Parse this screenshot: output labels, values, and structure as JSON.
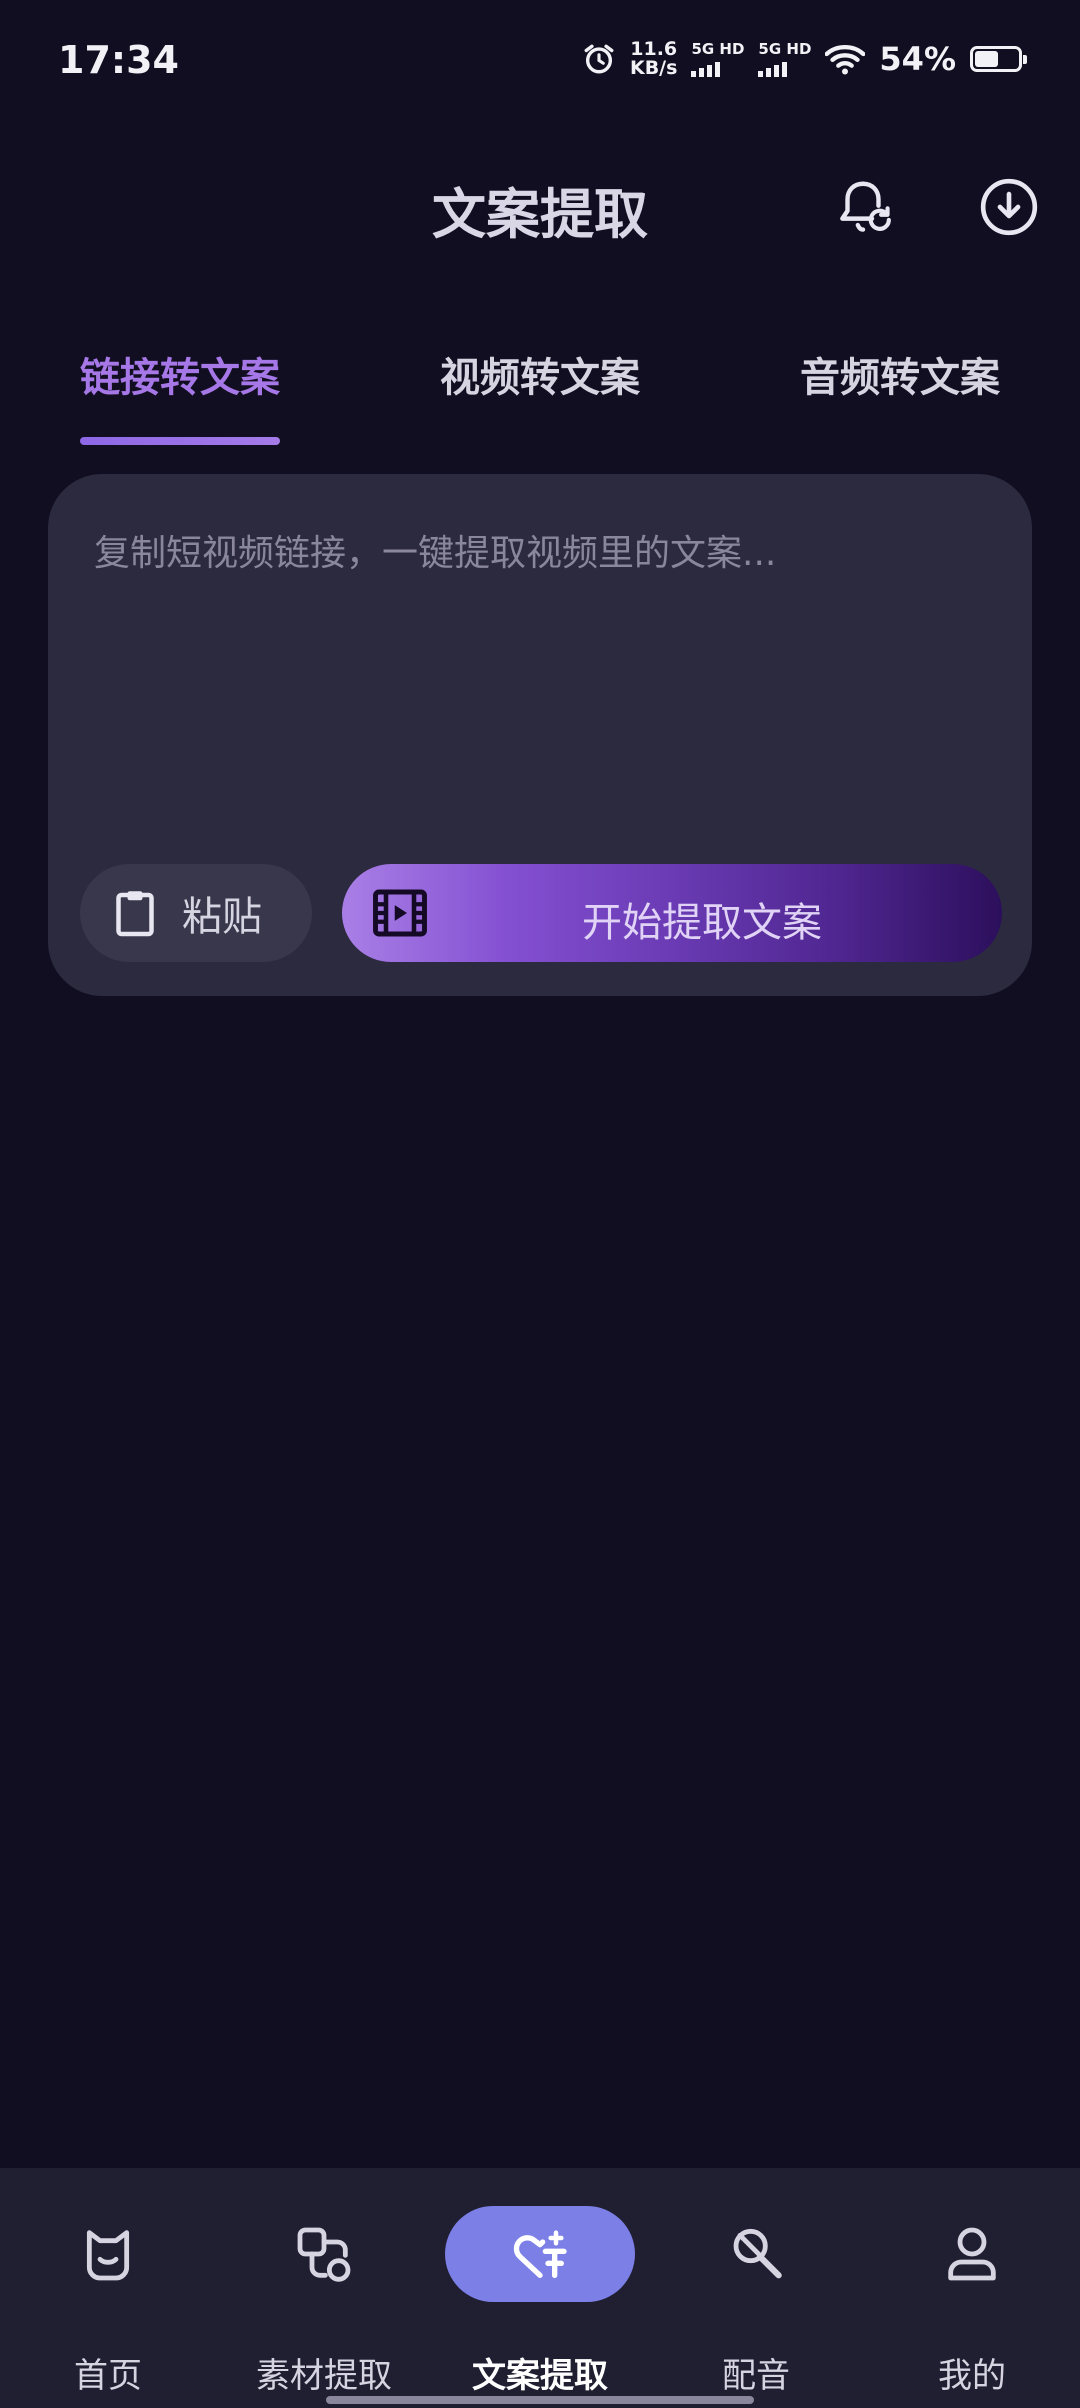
{
  "status_bar": {
    "time": "17:34",
    "net_speed_value": "11.6",
    "net_speed_unit": "KB/s",
    "sim1_label": "5G HD",
    "sim2_label": "5G HD",
    "battery_percent": "54%",
    "battery_level": 0.54
  },
  "header": {
    "title": "文案提取",
    "icons": [
      "bell-sync-icon",
      "download-circle-icon"
    ]
  },
  "tabs": [
    {
      "label": "链接转文案",
      "active": true
    },
    {
      "label": "视频转文案",
      "active": false
    },
    {
      "label": "音频转文案",
      "active": false
    }
  ],
  "card": {
    "input_placeholder": "复制短视频链接，一键提取视频里的文案...",
    "input_value": "",
    "paste_label": "粘贴",
    "extract_label": "开始提取文案"
  },
  "bottom_nav": [
    {
      "label": "首页",
      "icon": "home-face-icon",
      "active": false
    },
    {
      "label": "素材提取",
      "icon": "shapes-icon",
      "active": false
    },
    {
      "label": "文案提取",
      "icon": "heart-text-icon",
      "active": true
    },
    {
      "label": "配音",
      "icon": "microphone-icon",
      "active": false
    },
    {
      "label": "我的",
      "icon": "person-icon",
      "active": false
    }
  ],
  "colors": {
    "background": "#110e21",
    "card": "#2c2a3e",
    "accent": "#a677e6",
    "nav_active": "#7b7fe6"
  }
}
